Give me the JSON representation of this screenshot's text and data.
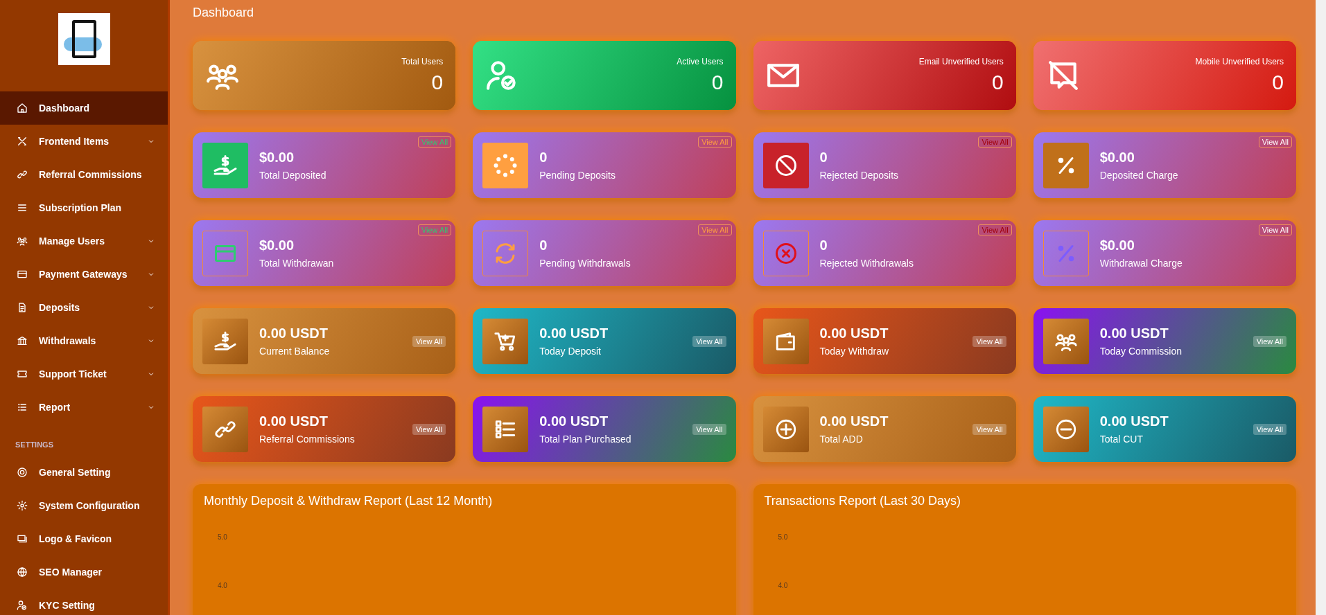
{
  "sidebar": {
    "items": [
      {
        "label": "Dashboard",
        "selected": true,
        "expandable": false
      },
      {
        "label": "Frontend Items",
        "selected": false,
        "expandable": true
      },
      {
        "label": "Referral Commissions",
        "selected": false,
        "expandable": false
      },
      {
        "label": "Subscription Plan",
        "selected": false,
        "expandable": false
      },
      {
        "label": "Manage Users",
        "selected": false,
        "expandable": true
      },
      {
        "label": "Payment Gateways",
        "selected": false,
        "expandable": true
      },
      {
        "label": "Deposits",
        "selected": false,
        "expandable": true
      },
      {
        "label": "Withdrawals",
        "selected": false,
        "expandable": true
      },
      {
        "label": "Support Ticket",
        "selected": false,
        "expandable": true
      },
      {
        "label": "Report",
        "selected": false,
        "expandable": true
      }
    ],
    "section_heading": "SETTINGS",
    "settings_items": [
      {
        "label": "General Setting",
        "selected": false
      },
      {
        "label": "System Configuration",
        "selected": false
      },
      {
        "label": "Logo & Favicon",
        "selected": false
      },
      {
        "label": "SEO Manager",
        "selected": false
      },
      {
        "label": "KYC Setting",
        "selected": false
      }
    ]
  },
  "page_title": "Dashboard",
  "user_widgets": [
    {
      "label": "Total Users",
      "value": "0"
    },
    {
      "label": "Active Users",
      "value": "0"
    },
    {
      "label": "Email Unverified Users",
      "value": "0"
    },
    {
      "label": "Mobile Unverified Users",
      "value": "0"
    }
  ],
  "payment_widgets": [
    {
      "value": "$0.00",
      "label": "Total Deposited",
      "link": "View All"
    },
    {
      "value": "0",
      "label": "Pending Deposits",
      "link": "View All"
    },
    {
      "value": "0",
      "label": "Rejected Deposits",
      "link": "View All"
    },
    {
      "value": "$0.00",
      "label": "Deposited Charge",
      "link": "View All"
    },
    {
      "value": "$0.00",
      "label": "Total Withdrawan",
      "link": "View All"
    },
    {
      "value": "0",
      "label": "Pending Withdrawals",
      "link": "View All"
    },
    {
      "value": "0",
      "label": "Rejected Withdrawals",
      "link": "View All"
    },
    {
      "value": "$0.00",
      "label": "Withdrawal Charge",
      "link": "View All"
    }
  ],
  "balance_widgets": [
    {
      "value": "0.00 USDT",
      "label": "Current Balance",
      "link": "View All"
    },
    {
      "value": "0.00 USDT",
      "label": "Today Deposit",
      "link": "View All"
    },
    {
      "value": "0.00 USDT",
      "label": "Today Withdraw",
      "link": "View All"
    },
    {
      "value": "0.00 USDT",
      "label": "Today Commission",
      "link": "View All"
    },
    {
      "value": "0.00 USDT",
      "label": "Referral Commissions",
      "link": "View All"
    },
    {
      "value": "0.00 USDT",
      "label": "Total Plan Purchased",
      "link": "View All"
    },
    {
      "value": "0.00 USDT",
      "label": "Total ADD",
      "link": "View All"
    },
    {
      "value": "0.00 USDT",
      "label": "Total CUT",
      "link": "View All"
    }
  ],
  "charts": [
    {
      "title": "Monthly Deposit & Withdraw Report (Last 12 Month)",
      "y_tick_labels": [
        "5.0",
        "4.0"
      ]
    },
    {
      "title": "Transactions Report (Last 30 Days)",
      "y_tick_labels": [
        "5.0",
        "4.0"
      ]
    }
  ]
}
